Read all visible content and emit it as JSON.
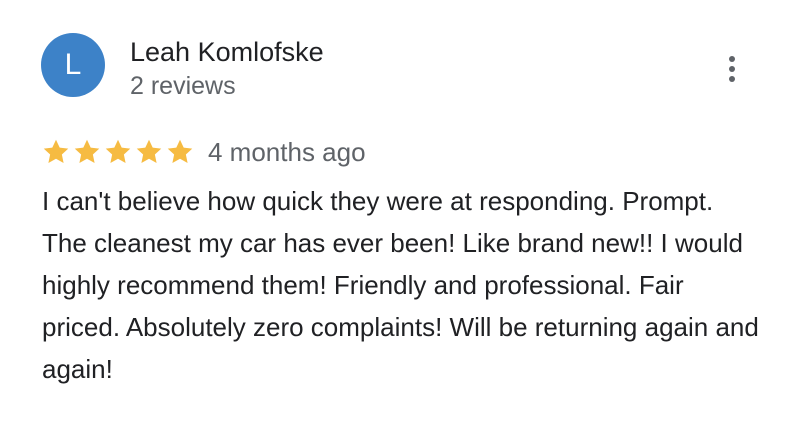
{
  "reviewer": {
    "avatar_initial": "L",
    "avatar_color": "#3d82c8",
    "name": "Leah Komlofske",
    "meta": "2 reviews"
  },
  "menu": {
    "icon": "more-vert-icon"
  },
  "review": {
    "rating": 5,
    "max_rating": 5,
    "star_color": "#f6bb42",
    "date": "4 months ago",
    "text": "I can't believe how quick they were at responding. Prompt. The cleanest my car has ever been! Like brand new!! I would highly recommend them! Friendly and professional. Fair priced. Absolutely zero complaints! Will be returning again and again!"
  }
}
